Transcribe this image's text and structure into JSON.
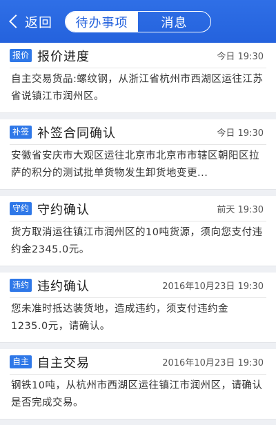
{
  "header": {
    "back_label": "返回",
    "tabs": [
      {
        "label": "待办事项",
        "active": true
      },
      {
        "label": "消息",
        "active": false
      }
    ],
    "bg_color": "#2462dd"
  },
  "items": [
    {
      "badge": "报价",
      "title": "报价进度",
      "time": "今日 19:30",
      "body": "自主交易货品:螺纹钢，从浙江省杭州市西湖区运往江苏省说镇江市润州区。"
    },
    {
      "badge": "补签",
      "title": "补签合同确认",
      "time": "今日 19:30",
      "body": "安徽省安庆市大观区运往北京市北京市市辖区朝阳区拉萨的积分的测试批单货物发生卸货地变更..."
    },
    {
      "badge": "守约",
      "title": "守约确认",
      "time": "前天 19:30",
      "body": "货方取消运往镇江市润州区的10吨货源，须向您支付违约金2345.0元。"
    },
    {
      "badge": "违约",
      "title": "违约确认",
      "time": "2016年10月23日 19:30",
      "body": "您未准时抵达装货地，造成违约，须支付违约金1235.0元，请确认。"
    },
    {
      "badge": "自主",
      "title": "自主交易",
      "time": "2016年10月23日 19:30",
      "body": "钢铁10吨，从杭州市西湖区运往镇江市润州区，请确认是否完成交易。"
    }
  ]
}
